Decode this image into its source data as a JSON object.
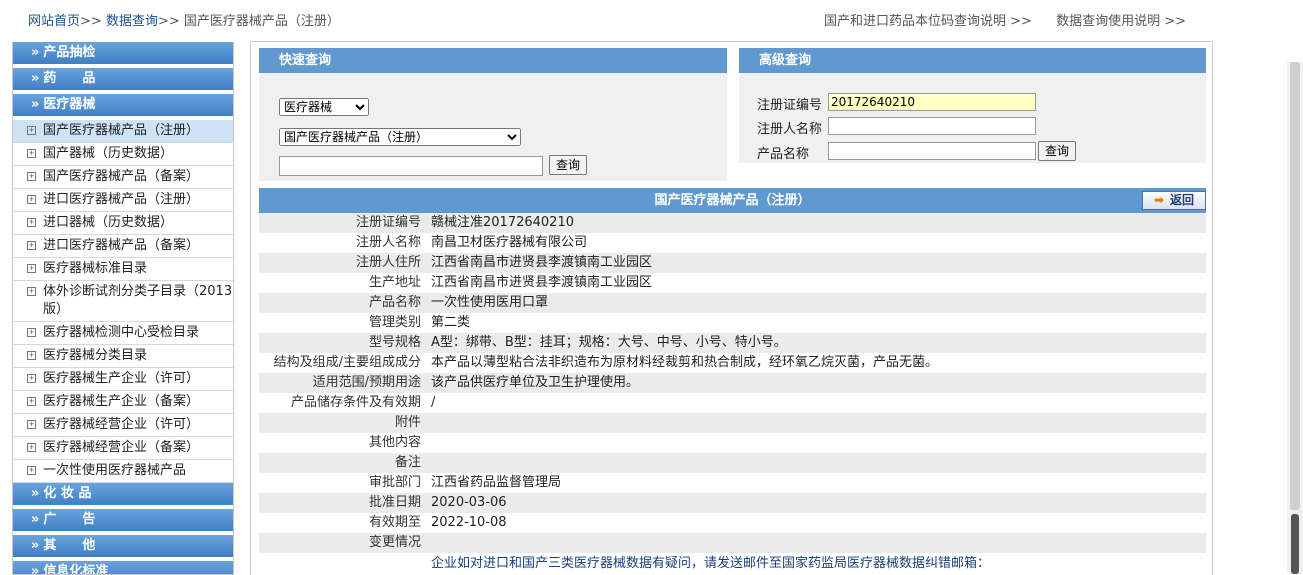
{
  "breadcrumb": {
    "home": "网站首页",
    "sep": ">>",
    "query": "数据查询",
    "current": "国产医疗器械产品（注册）"
  },
  "top_links": [
    "国产和进口药品本位码查询说明 >>",
    "数据查询使用说明 >>"
  ],
  "sidebar": {
    "categories_top": [
      "产品抽检",
      "药　　品",
      "医疗器械"
    ],
    "items": [
      "国产医疗器械产品（注册）",
      "国产器械（历史数据）",
      "国产医疗器械产品（备案）",
      "进口医疗器械产品（注册）",
      "进口器械（历史数据）",
      "进口医疗器械产品（备案）",
      "医疗器械标准目录",
      "体外诊断试剂分类子目录（2013版）",
      "医疗器械检测中心受检目录",
      "医疗器械分类目录",
      "医疗器械生产企业（许可）",
      "医疗器械生产企业（备案）",
      "医疗器械经营企业（许可）",
      "医疗器械经营企业（备案）",
      "一次性使用医疗器械产品"
    ],
    "categories_bottom": [
      "化 妆 品",
      "广　　告",
      "其　　他",
      "信息化标准"
    ]
  },
  "quick_search": {
    "title": "快速查询",
    "category_selected": "医疗器械",
    "database_selected": "国产医疗器械产品（注册）",
    "keyword_value": "",
    "button": "查询"
  },
  "advanced_search": {
    "title": "高级查询",
    "reg_no_label": "注册证编号",
    "reg_no_value": "20172640210",
    "registrant_label": "注册人名称",
    "registrant_value": "",
    "product_label": "产品名称",
    "product_value": "",
    "button": "查询"
  },
  "detail": {
    "title": "国产医疗器械产品（注册）",
    "back_button": "返回",
    "rows": [
      {
        "k": "注册证编号",
        "v": "赣械注准20172640210"
      },
      {
        "k": "注册人名称",
        "v": "南昌卫材医疗器械有限公司"
      },
      {
        "k": "注册人住所",
        "v": "江西省南昌市进贤县李渡镇南工业园区"
      },
      {
        "k": "生产地址",
        "v": "江西省南昌市进贤县李渡镇南工业园区"
      },
      {
        "k": "产品名称",
        "v": "一次性使用医用口罩"
      },
      {
        "k": "管理类别",
        "v": "第二类"
      },
      {
        "k": "型号规格",
        "v": "A型：绑带、B型：挂耳；规格：大号、中号、小号、特小号。"
      },
      {
        "k": "结构及组成/主要组成成分",
        "v": "本产品以薄型粘合法非织造布为原材料经裁剪和热合制成，经环氧乙烷灭菌，产品无菌。"
      },
      {
        "k": "适用范围/预期用途",
        "v": "该产品供医疗单位及卫生护理使用。"
      },
      {
        "k": "产品储存条件及有效期",
        "v": "/"
      },
      {
        "k": "附件",
        "v": ""
      },
      {
        "k": "其他内容",
        "v": ""
      },
      {
        "k": "备注",
        "v": ""
      },
      {
        "k": "审批部门",
        "v": "江西省药品监督管理局"
      },
      {
        "k": "批准日期",
        "v": "2020-03-06"
      },
      {
        "k": "有效期至",
        "v": "2022-10-08"
      },
      {
        "k": "变更情况",
        "v": ""
      }
    ],
    "notice": "企业如对进口和国产三类医疗器械数据有疑问，请发送邮件至国家药监局医疗器械数据纠错邮箱："
  }
}
